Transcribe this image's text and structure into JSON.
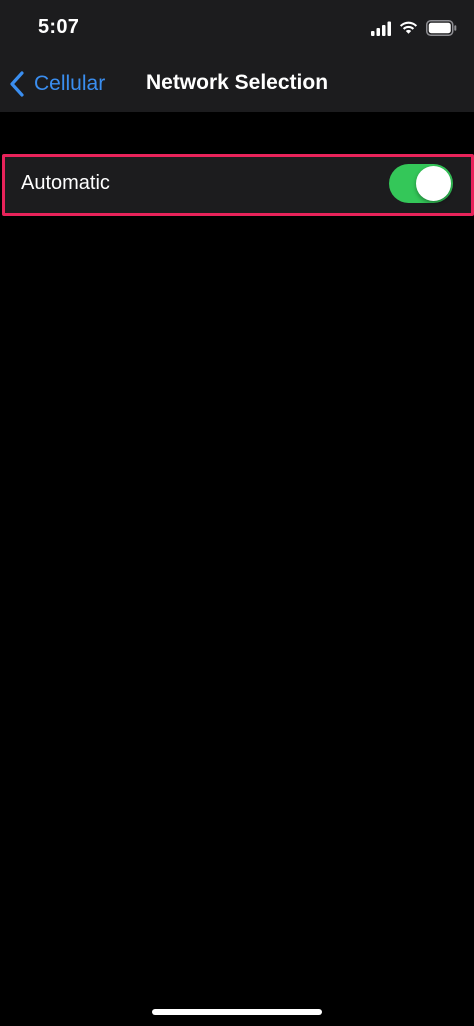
{
  "status_bar": {
    "time": "5:07",
    "icons": [
      "cellular-signal-icon",
      "wifi-icon",
      "battery-icon"
    ]
  },
  "nav": {
    "back_label": "Cellular",
    "title": "Network Selection"
  },
  "settings": {
    "automatic_label": "Automatic",
    "automatic_on": true
  },
  "colors": {
    "accent_blue": "#3a8ef0",
    "toggle_on": "#34c759",
    "highlight": "#e8235a",
    "background": "#000000",
    "cell_background": "#1c1c1e"
  }
}
